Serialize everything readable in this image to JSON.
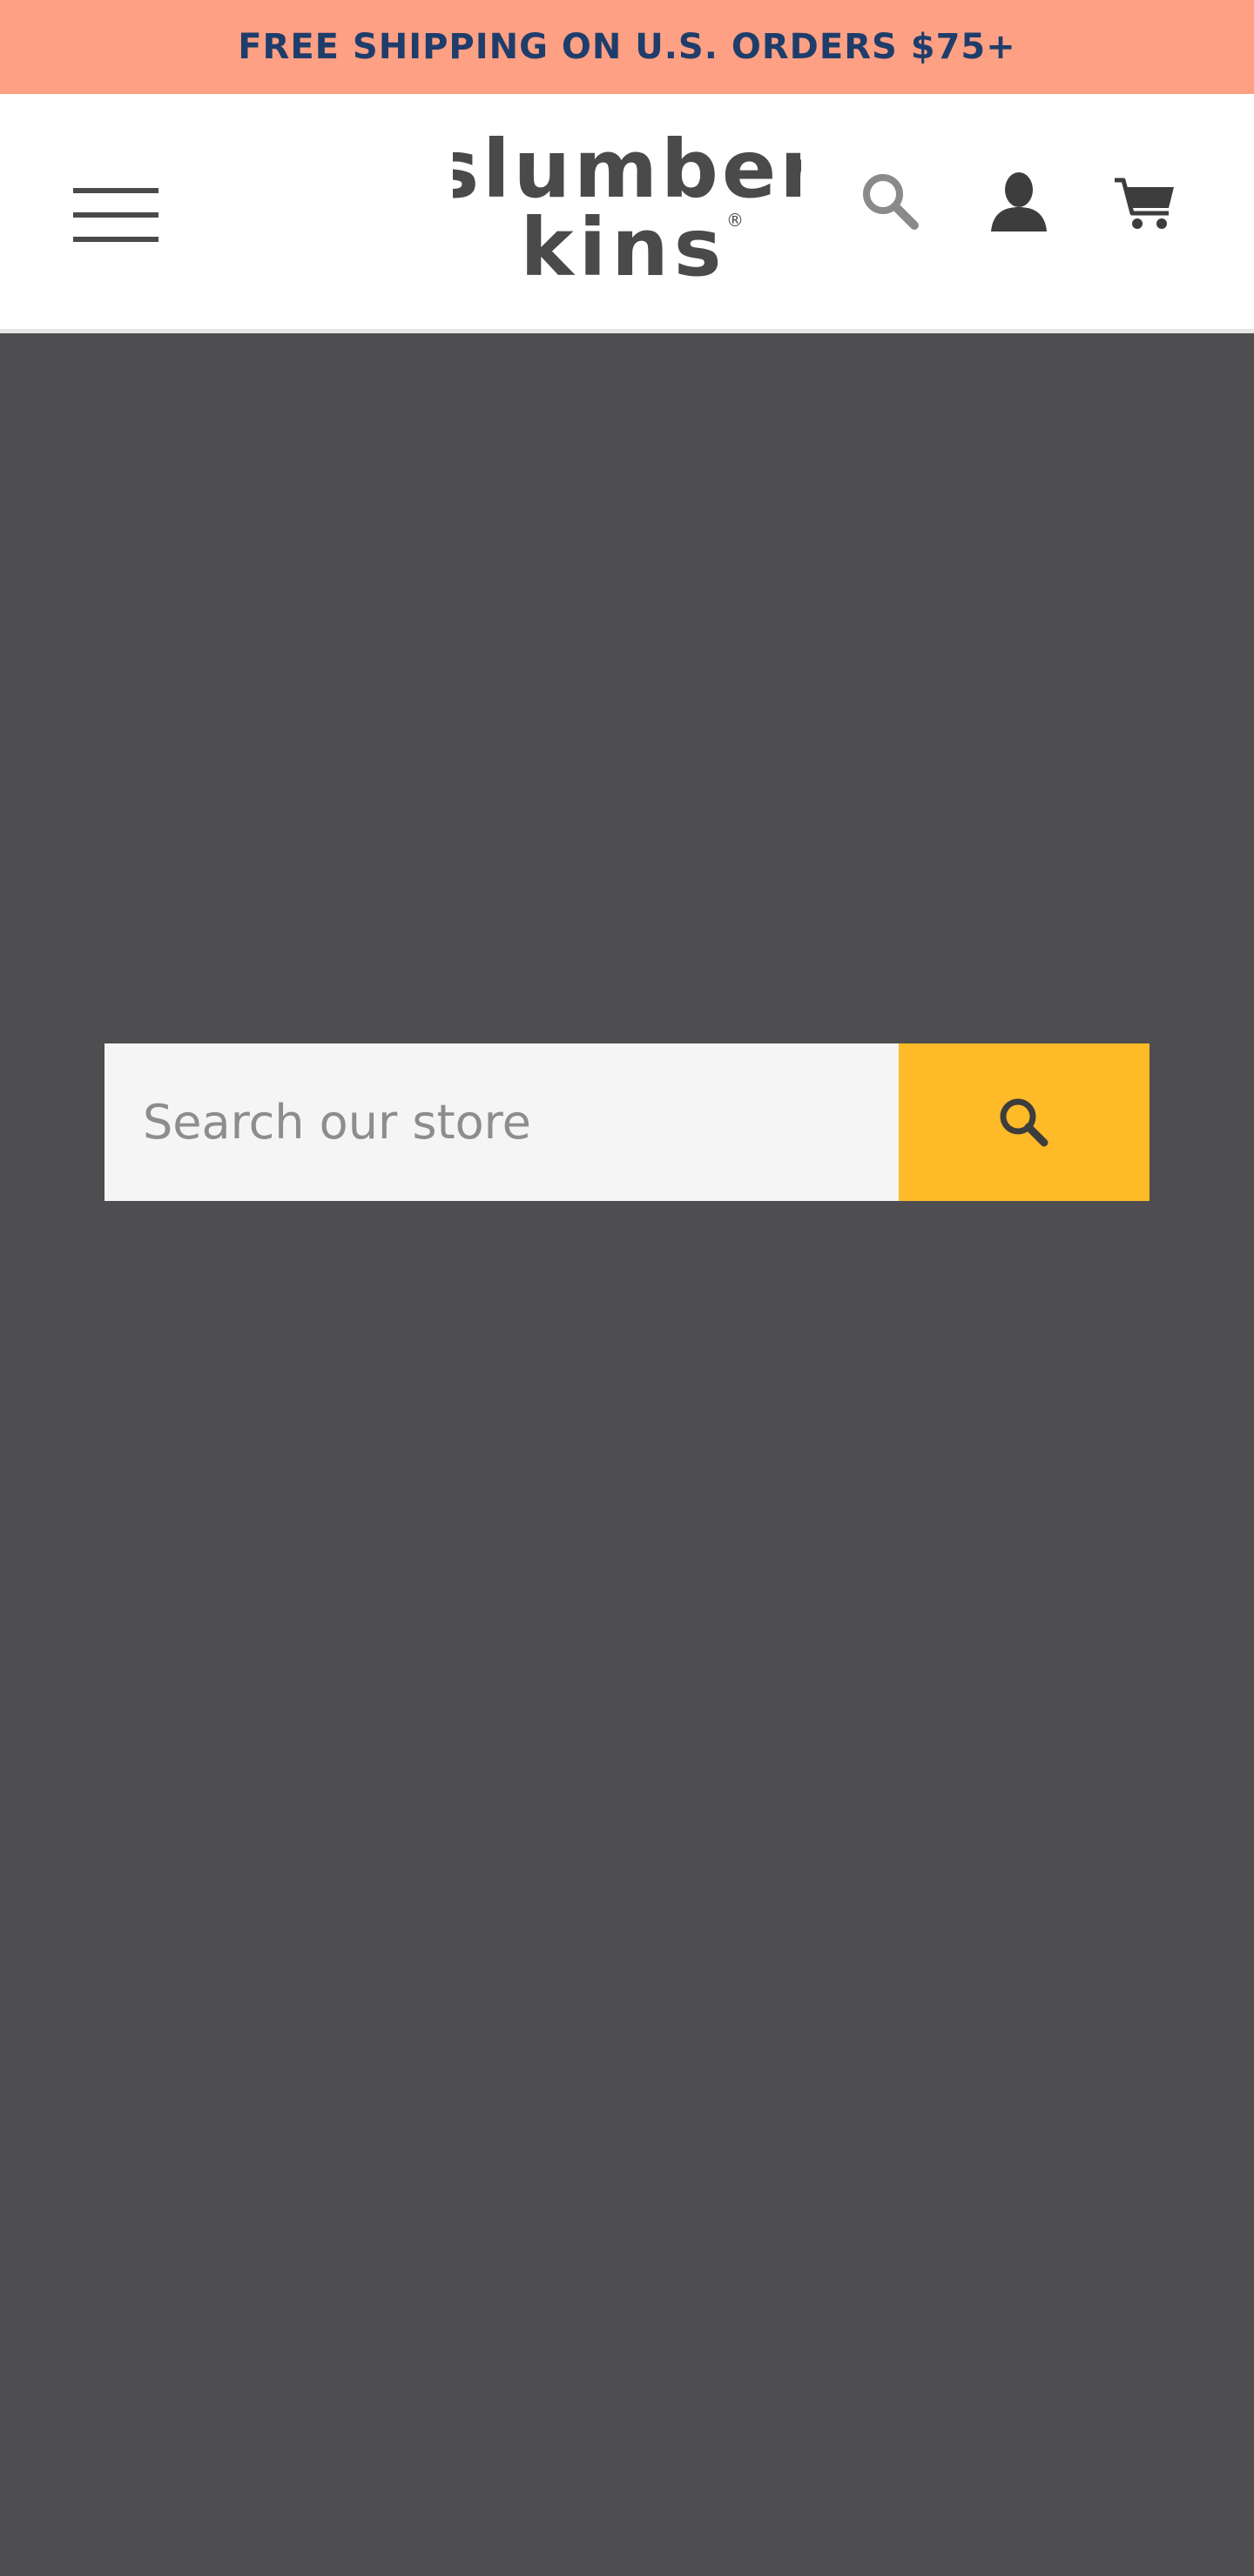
{
  "announcement": {
    "text": "FREE SHIPPING ON U.S. ORDERS $75+",
    "background": "#fda083",
    "color": "#1f3d6b"
  },
  "header": {
    "logo": {
      "line1": "slumber",
      "line2": "kins",
      "registered_mark": "®"
    },
    "icons": [
      "menu-icon",
      "search-icon",
      "account-icon",
      "cart-icon"
    ]
  },
  "search": {
    "placeholder": "Search our store",
    "value": "",
    "button_color": "#ffba27",
    "icon": "search-icon"
  },
  "colors": {
    "overlay": "#4e4e50",
    "header_bg": "#ffffff",
    "icon_dark": "#3d3d3d",
    "icon_muted": "#8a8a8a"
  }
}
